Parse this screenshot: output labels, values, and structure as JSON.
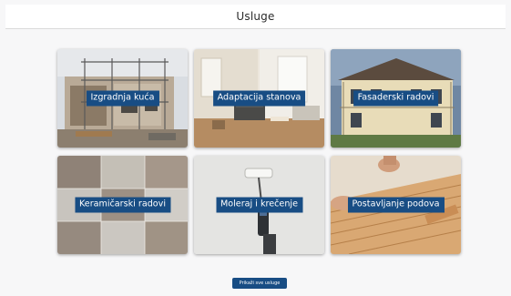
{
  "header": {
    "title": "Usluge"
  },
  "services": [
    {
      "label": "Izgradnja kuća"
    },
    {
      "label": "Adaptacija stanova"
    },
    {
      "label": "Fasaderski radovi"
    },
    {
      "label": "Keramičarski radovi"
    },
    {
      "label": "Moleraj i krečenje"
    },
    {
      "label": "Postavljanje podova"
    }
  ],
  "footer": {
    "button_label": "Prikaži sve usluge"
  },
  "colors": {
    "accent": "#184d84",
    "background": "#f7f7f8",
    "header_bg": "#ffffff"
  }
}
